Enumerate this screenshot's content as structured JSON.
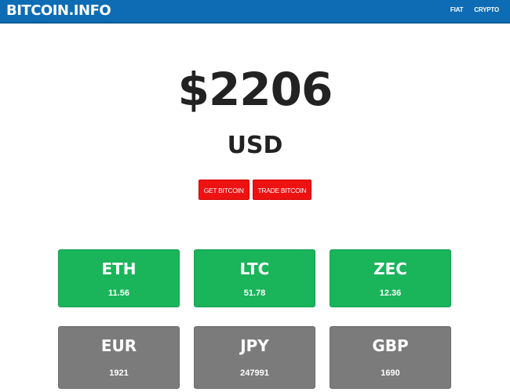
{
  "navbar": {
    "brand": "BITCOIN.INFO",
    "links": [
      "FIAT",
      "CRYPTO"
    ],
    "bg_color": "#0d6cb3"
  },
  "hero": {
    "price": "$2206",
    "currency": "USD"
  },
  "actions": {
    "get_label": "GET BITCOIN",
    "trade_label": "TRADE BITCOIN",
    "color": "#ee1111"
  },
  "crypto_tiles": [
    {
      "symbol": "ETH",
      "value": "11.56"
    },
    {
      "symbol": "LTC",
      "value": "51.78"
    },
    {
      "symbol": "ZEC",
      "value": "12.36"
    }
  ],
  "fiat_tiles": [
    {
      "symbol": "EUR",
      "value": "1921"
    },
    {
      "symbol": "JPY",
      "value": "247991"
    },
    {
      "symbol": "GBP",
      "value": "1690"
    }
  ],
  "colors": {
    "crypto_tile": "#1ab45a",
    "fiat_tile": "#7b7b7b"
  }
}
